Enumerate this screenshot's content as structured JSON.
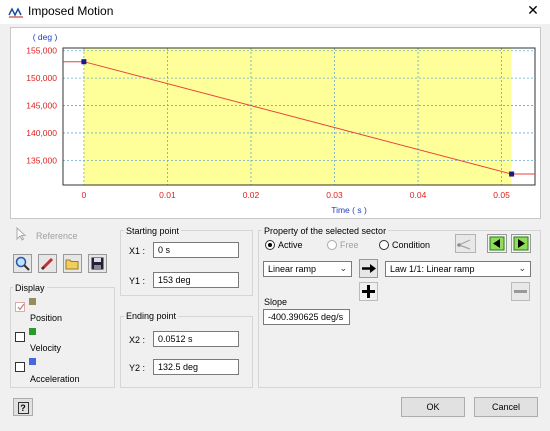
{
  "window": {
    "title": "Imposed Motion",
    "close": "✕"
  },
  "chart_data": {
    "type": "line",
    "title": "",
    "xlabel": "Time ( s )",
    "ylabel": "( deg )",
    "xlim": [
      -0.0025,
      0.054
    ],
    "ylim": [
      130500,
      155500
    ],
    "xticks": [
      0,
      0.01,
      0.02,
      0.03,
      0.04,
      0.05
    ],
    "xtick_labels": [
      "0",
      "0.01",
      "0.02",
      "0.03",
      "0.04",
      "0.05"
    ],
    "yticks": [
      135000,
      140000,
      145000,
      150000,
      155000
    ],
    "ytick_labels": [
      "135,000",
      "140,000",
      "145,000",
      "150,000",
      "155,000"
    ],
    "highlight_sector": [
      0,
      0.0512
    ],
    "series": [
      {
        "x": [
          -0.0025,
          0,
          0.0512,
          0.054
        ],
        "y": [
          153000,
          153000,
          132500,
          132500
        ]
      }
    ],
    "markers": [
      {
        "x": 0,
        "y": 153000
      },
      {
        "x": 0.0512,
        "y": 132500
      }
    ],
    "colors": {
      "line": "#e8423a",
      "sector": "#ffff99",
      "marker": "#1a1a8a",
      "ylabels": "#e02020",
      "xlabels": "#e02020",
      "axis_title": "#2040c0"
    }
  },
  "toolbar": {
    "reference_label": "Reference"
  },
  "display": {
    "title": "Display",
    "items": [
      {
        "label": "Position",
        "checked": true,
        "color": "#9b8a5a"
      },
      {
        "label": "Velocity",
        "checked": false,
        "color": "#2a9a2a"
      },
      {
        "label": "Acceleration",
        "checked": false,
        "color": "#4a66dd"
      }
    ]
  },
  "starting_point": {
    "title": "Starting point",
    "x_label": "X1 :",
    "x_value": "0 s",
    "y_label": "Y1 :",
    "y_value": "153 deg"
  },
  "ending_point": {
    "title": "Ending point",
    "x_label": "X2 :",
    "x_value": "0.0512 s",
    "y_label": "Y2 :",
    "y_value": "132.5 deg"
  },
  "property": {
    "title": "Property of the selected sector",
    "modes": [
      "Active",
      "Free",
      "Condition"
    ],
    "selected_mode": "Active",
    "ramp_select": "Linear ramp",
    "law_select": "Law 1/1: Linear ramp",
    "slope_label": "Slope",
    "slope_value": "-400.390625 deg/s"
  },
  "buttons": {
    "ok": "OK",
    "cancel": "Cancel",
    "help": "?"
  }
}
